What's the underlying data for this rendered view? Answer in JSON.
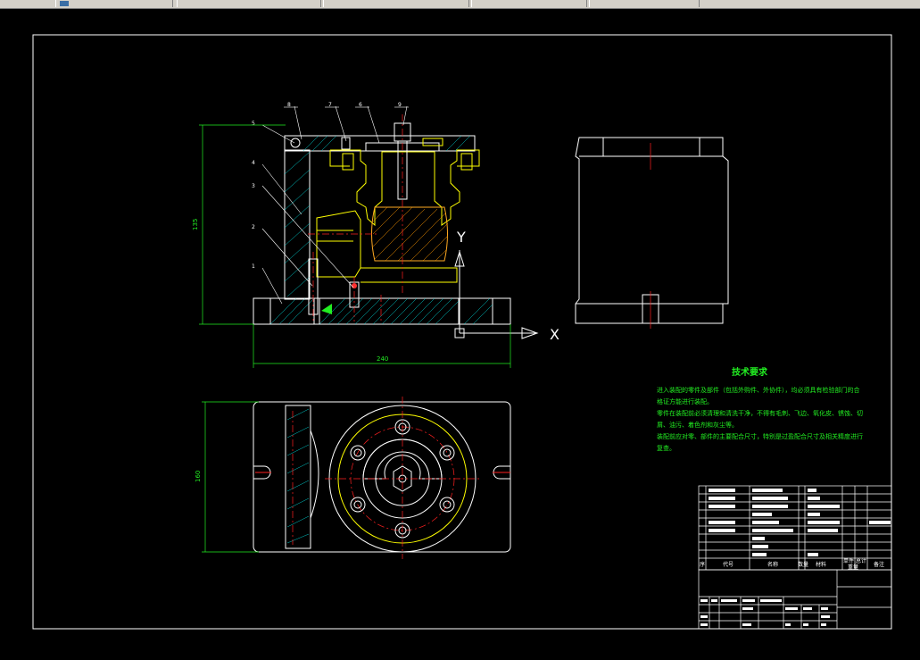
{
  "toolbar": {
    "tabs": [
      "",
      "",
      "",
      "",
      ""
    ]
  },
  "drawing": {
    "balloons": [
      "8",
      "7",
      "6",
      "9",
      "5",
      "4",
      "3",
      "2",
      "1"
    ],
    "axis_y": "Y",
    "axis_x": "X",
    "dim_height": "135",
    "dim_width": "240",
    "dim_plan": "160",
    "tech_title": "技术要求",
    "tech_lines": [
      "进入装配的零件及部件（包括外购件、外协件），均必须具有检验部门的合",
      "格证方能进行装配。",
      "零件在装配前必须清理和清洗干净，不得有毛刺、飞边、氧化皮、锈蚀、切",
      "屑、油污、着色剂和灰尘等。",
      "装配前应对零、部件的主要配合尺寸，特别是过盈配合尺寸及相关精度进行",
      "复查。"
    ]
  },
  "title_block": {
    "headers": [
      "序",
      "代号",
      "名称",
      "数量",
      "材料",
      "单件",
      "总计",
      "备注"
    ],
    "weight_label": "重量"
  },
  "colors": {
    "background": "#000000",
    "outline": "#ffffff",
    "part": "#ffff00",
    "dimension": "#00ff00",
    "center_line": "#ff2020",
    "hatch": "#00ffff"
  }
}
